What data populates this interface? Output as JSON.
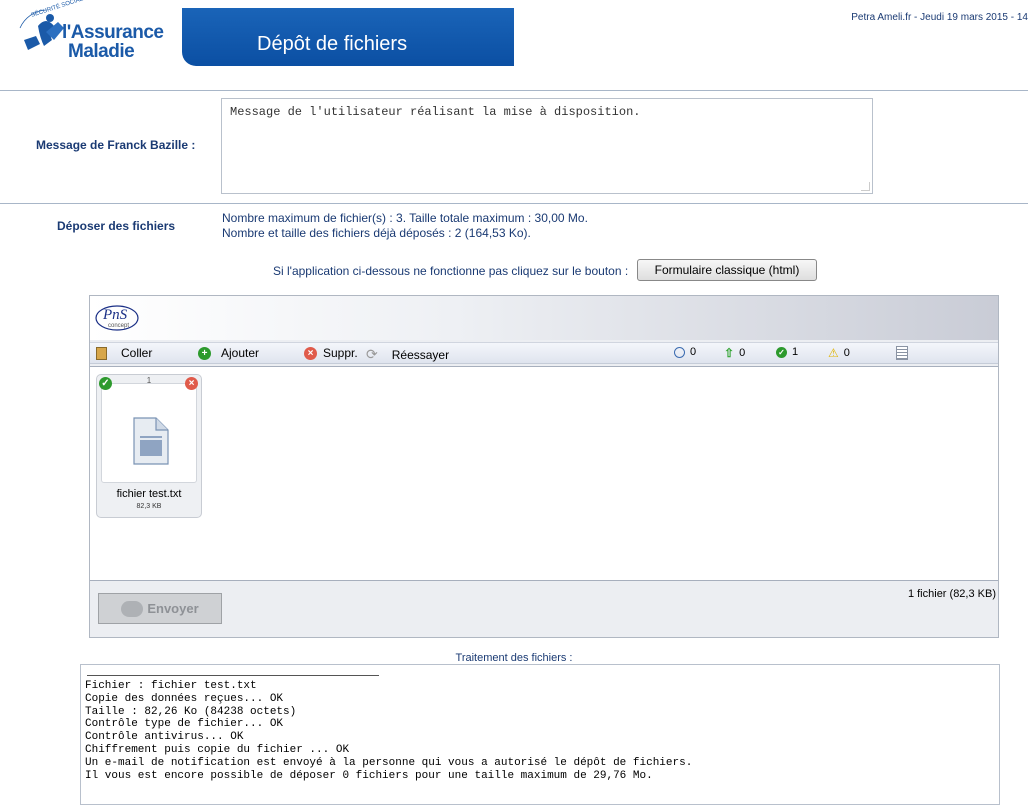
{
  "header": {
    "logo_arc_text": "SÉCURITÉ SOCIALE",
    "logo_line1": "l'Assurance",
    "logo_line2": "Maladie",
    "banner_title": "Dépôt de fichiers",
    "user_info": "Petra Ameli.fr - Jeudi 19 mars 2015 - 14"
  },
  "message": {
    "label": "Message de Franck Bazille :",
    "value": "Message de l'utilisateur réalisant la mise à disposition."
  },
  "depot": {
    "label": "Déposer des fichiers",
    "info_line1": "Nombre maximum de fichier(s) : 3. Taille totale maximum : 30,00 Mo.",
    "info_line2": "Nombre et taille des fichiers déjà déposés : 2 (164,53 Ko).",
    "fallback_text": "Si l'application ci-dessous ne fonctionne pas cliquez sur le bouton :",
    "fallback_button": "Formulaire classique (html)"
  },
  "uploader": {
    "logo_text": "PnS",
    "logo_subtext": "concept",
    "toolbar": {
      "paste": "Coller",
      "add": "Ajouter",
      "delete": "Suppr.",
      "retry": "Réessayer"
    },
    "stats": {
      "pending": "0",
      "uploading": "0",
      "done": "1",
      "warnings": "0"
    },
    "files": [
      {
        "index": "1",
        "name": "fichier test.txt",
        "size": "82,3 KB",
        "status": "ok"
      }
    ],
    "send_button": "Envoyer",
    "file_count": "1 fichier (82,3 KB)"
  },
  "log": {
    "title": "Traitement des fichiers :",
    "lines": [
      "Fichier : fichier test.txt",
      "Copie des données reçues... OK",
      "Taille : 82,26 Ko (84238 octets)",
      "Contrôle type de fichier... OK",
      "Contrôle antivirus... OK",
      "Chiffrement puis copie du fichier ... OK",
      "Un e-mail de notification est envoyé à la personne qui vous a autorisé le dépôt de fichiers.",
      "Il vous est encore possible de déposer 0 fichiers pour une taille maximum de 29,76 Mo."
    ]
  },
  "colors": {
    "banner": "#0b4fa3",
    "text": "#1a3a73",
    "ok_green": "#2d9a2d",
    "delete_red": "#e05b4b"
  }
}
